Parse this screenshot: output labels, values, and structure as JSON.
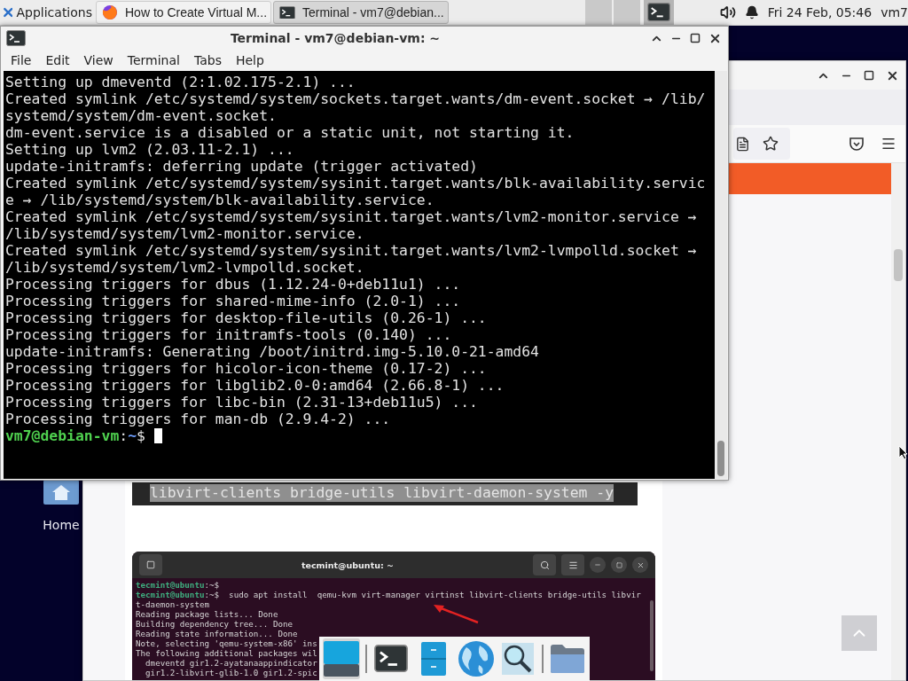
{
  "top_panel": {
    "menu_label": "Applications",
    "tasks": [
      {
        "kind": "browser",
        "label": "How to Create Virtual M...",
        "selected": false
      },
      {
        "kind": "terminal",
        "label": "Terminal - vm7@debian...",
        "selected": true
      }
    ],
    "clock": "Fri 24 Feb, 05:46",
    "user": "vm7"
  },
  "desktop_icons": [
    {
      "label": "Home"
    }
  ],
  "browser": {
    "code_block": {
      "text": "libvirt-clients bridge-utils libvirt-daemon-system -y"
    },
    "screenshot": {
      "title": "tecmint@ubuntu: ~",
      "lines": [
        {
          "prompt": "tecmint@ubuntu",
          "text": ":~$"
        },
        {
          "prompt": "tecmint@ubuntu",
          "text": ":~$  sudo apt install  qemu-kvm virt-manager virtinst libvirt-clients bridge-utils libvir"
        },
        {
          "text": "t-daemon-system"
        },
        {
          "text": "Reading package lists... Done"
        },
        {
          "text": "Building dependency tree... Done"
        },
        {
          "text": "Reading state information... Done"
        },
        {
          "text": "Note, selecting 'qemu-system-x86' ins"
        },
        {
          "text": "The following additional packages wil"
        },
        {
          "text": "  dmeventd gir1.2-ayatanaappindicator"
        },
        {
          "text": "  gir1.2-libvirt-glib-1.0 gir1.2-spic"
        }
      ]
    }
  },
  "terminal": {
    "title": "Terminal - vm7@debian-vm: ~",
    "menu": [
      "File",
      "Edit",
      "View",
      "Terminal",
      "Tabs",
      "Help"
    ],
    "lines": [
      "Setting up dmeventd (2:1.02.175-2.1) ...",
      "Created symlink /etc/systemd/system/sockets.target.wants/dm-event.socket → /lib/",
      "systemd/system/dm-event.socket.",
      "dm-event.service is a disabled or a static unit, not starting it.",
      "Setting up lvm2 (2.03.11-2.1) ...",
      "update-initramfs: deferring update (trigger activated)",
      "Created symlink /etc/systemd/system/sysinit.target.wants/blk-availability.servic",
      "e → /lib/systemd/system/blk-availability.service.",
      "Created symlink /etc/systemd/system/sysinit.target.wants/lvm2-monitor.service →",
      "/lib/systemd/system/lvm2-monitor.service.",
      "Created symlink /etc/systemd/system/sysinit.target.wants/lvm2-lvmpolld.socket →",
      "/lib/systemd/system/lvm2-lvmpolld.socket.",
      "Processing triggers for dbus (1.12.24-0+deb11u1) ...",
      "Processing triggers for shared-mime-info (2.0-1) ...",
      "Processing triggers for desktop-file-utils (0.26-1) ...",
      "Processing triggers for initramfs-tools (0.140) ...",
      "update-initramfs: Generating /boot/initrd.img-5.10.0-21-amd64",
      "Processing triggers for hicolor-icon-theme (0.17-2) ...",
      "Processing triggers for libglib2.0-0:amd64 (2.66.8-1) ...",
      "Processing triggers for libc-bin (2.31-13+deb11u5) ...",
      "Processing triggers for man-db (2.9.4-2) ..."
    ],
    "prompt": {
      "user_host": "vm7@debian-vm",
      "separator": ":",
      "path": "~",
      "symbol": "$"
    }
  },
  "dock": {
    "items": [
      {
        "kind": "show-desktop",
        "selected": true
      },
      {
        "kind": "separator"
      },
      {
        "kind": "terminal",
        "selected": false
      },
      {
        "kind": "files",
        "selected": false
      },
      {
        "kind": "browser",
        "selected": false
      },
      {
        "kind": "search",
        "selected": false
      },
      {
        "kind": "separator"
      },
      {
        "kind": "folder",
        "selected": false
      }
    ]
  }
}
